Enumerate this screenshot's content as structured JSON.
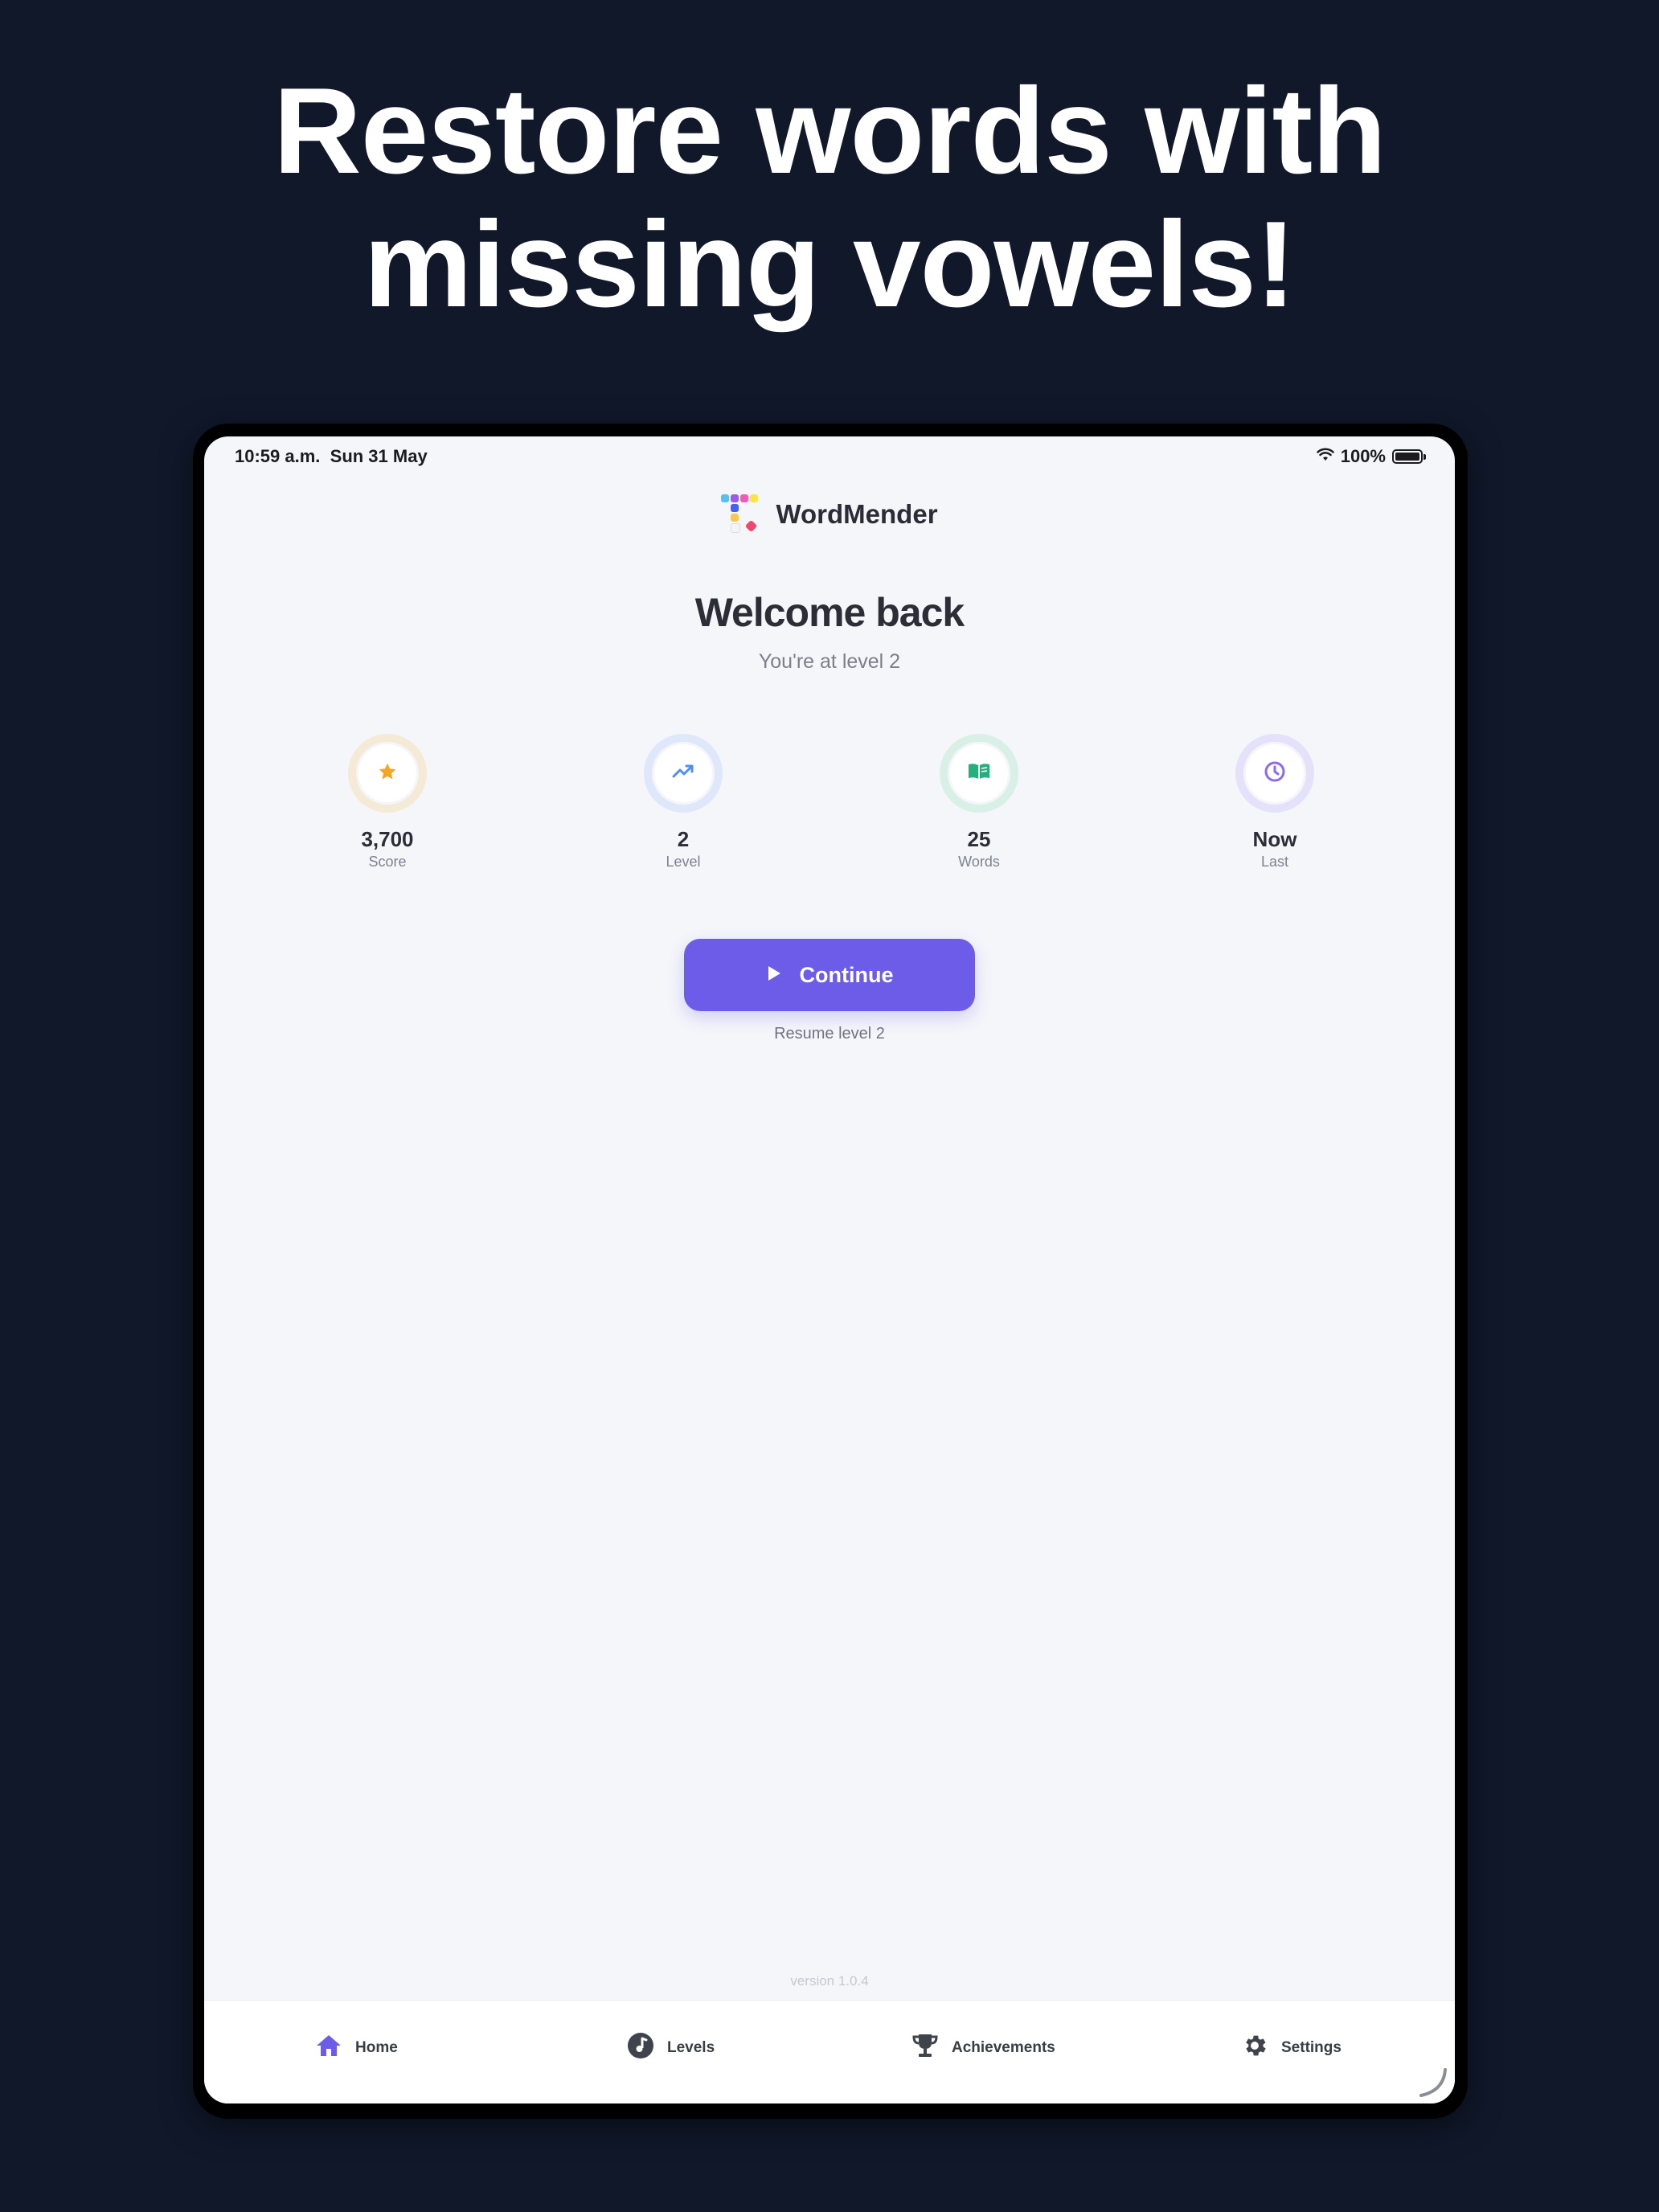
{
  "headline": {
    "line1": "Restore words with",
    "line2": "missing vowels!"
  },
  "status_bar": {
    "time": "10:59 a.m.",
    "date": "Sun 31 May",
    "battery": "100%",
    "wifi_icon": "wifi-icon",
    "battery_icon": "battery-icon"
  },
  "app": {
    "name": "WordMender",
    "logo_icon": "wordmender-logo-icon"
  },
  "welcome": {
    "title": "Welcome back",
    "subtitle": "You're at level 2"
  },
  "stats": [
    {
      "value": "3,700",
      "label": "Score",
      "icon": "star-icon",
      "color": "#f5a524",
      "ring": "#f5ead6"
    },
    {
      "value": "2",
      "label": "Level",
      "icon": "trending-up-icon",
      "color": "#4f8ef7",
      "ring": "#dfe8fb"
    },
    {
      "value": "25",
      "label": "Words",
      "icon": "book-icon",
      "color": "#22b07d",
      "ring": "#d8f0e6"
    },
    {
      "value": "Now",
      "label": "Last",
      "icon": "clock-icon",
      "color": "#8b6cf0",
      "ring": "#e6e1fa"
    }
  ],
  "continue": {
    "label": "Continue",
    "icon": "play-icon",
    "hint": "Resume level 2"
  },
  "version": "version 1.0.4",
  "tabs": [
    {
      "label": "Home",
      "icon": "home-icon",
      "active": true
    },
    {
      "label": "Levels",
      "icon": "music-note-icon",
      "active": false
    },
    {
      "label": "Achievements",
      "icon": "trophy-icon",
      "active": false
    },
    {
      "label": "Settings",
      "icon": "gear-icon",
      "active": false
    }
  ],
  "colors": {
    "accent": "#6c5ce7",
    "background": "#10182a",
    "screen": "#f4f6fa"
  }
}
